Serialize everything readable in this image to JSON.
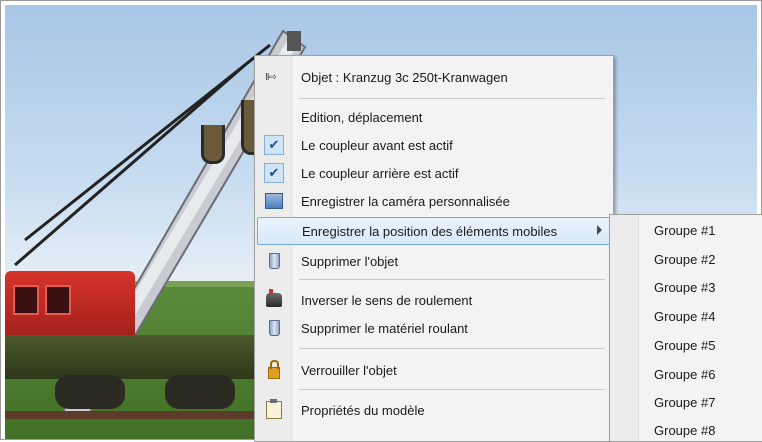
{
  "menu": {
    "header": {
      "label": "Objet : Kranzug 3c 250t-Kranwagen",
      "icon": "object-arrow-icon"
    },
    "items": [
      {
        "label": "Edition, déplacement",
        "icon": ""
      },
      {
        "label": "Le coupleur avant est actif",
        "icon": "checkmark-icon",
        "checked": true
      },
      {
        "label": "Le coupleur arrière est actif",
        "icon": "checkmark-icon",
        "checked": true
      },
      {
        "label": "Enregistrer la caméra personnalisée",
        "icon": "camera-icon"
      },
      {
        "label": "Enregistrer la position des éléments mobiles",
        "icon": "",
        "highlighted": true,
        "has_submenu": true
      },
      {
        "label": "Supprimer l'objet",
        "icon": "trash-icon"
      },
      {
        "label": "Inverser le sens de roulement",
        "icon": "locomotive-icon"
      },
      {
        "label": "Supprimer le matériel roulant",
        "icon": "trash-icon"
      },
      {
        "label": "Verrouiller l'objet",
        "icon": "lock-icon"
      },
      {
        "label": "Propriétés du modèle",
        "icon": "clipboard-icon"
      }
    ]
  },
  "submenu": {
    "items": [
      "Groupe #1",
      "Groupe #2",
      "Groupe #3",
      "Groupe #4",
      "Groupe #5",
      "Groupe #6",
      "Groupe #7",
      "Groupe #8"
    ]
  },
  "colors": {
    "highlight_border": "#7da7d3",
    "menu_bg": "#f3f3f3",
    "crane_red": "#d6332b"
  }
}
